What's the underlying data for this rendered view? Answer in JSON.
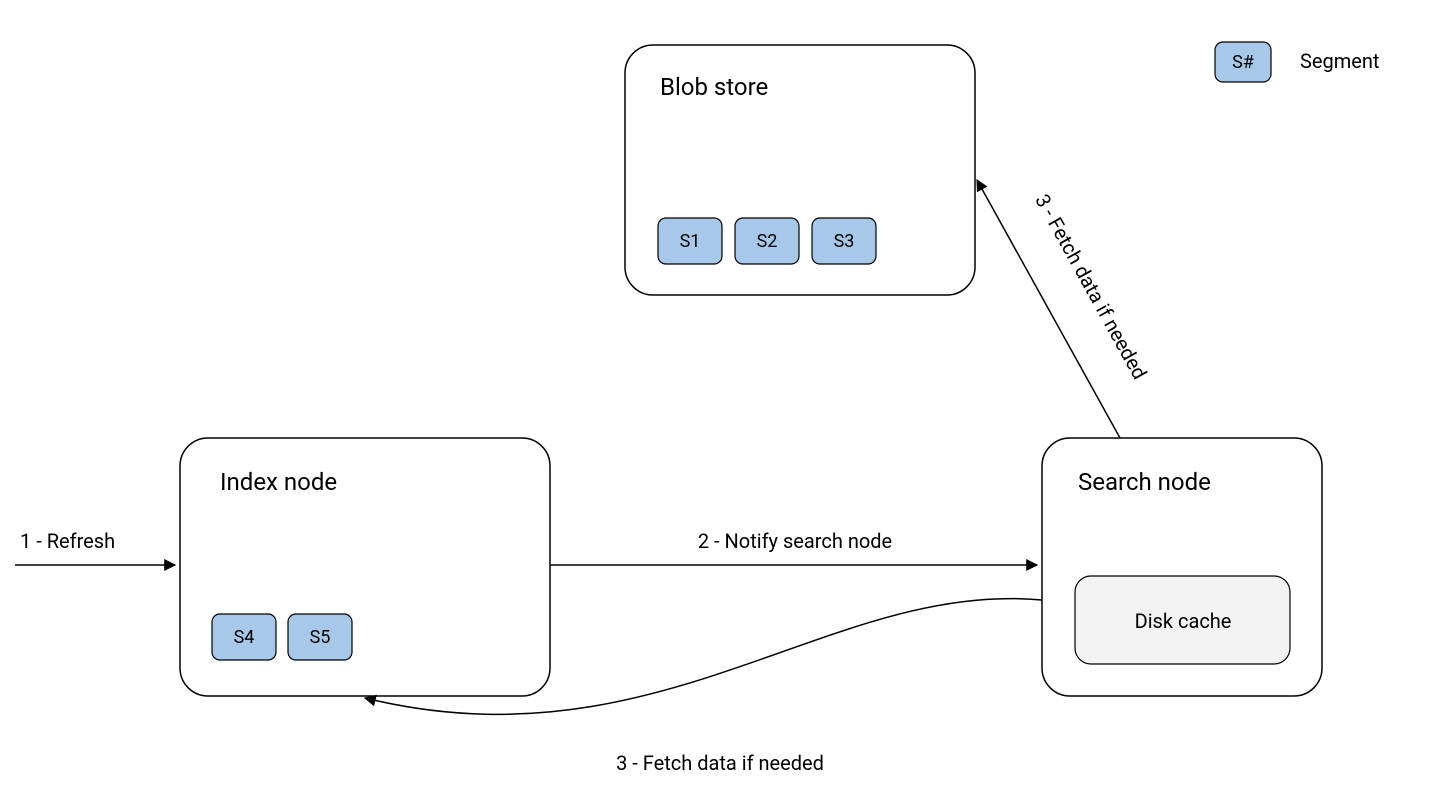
{
  "legend": {
    "swatch_label": "S#",
    "description": "Segment"
  },
  "nodes": {
    "blob_store": {
      "title": "Blob store",
      "segments": [
        "S1",
        "S2",
        "S3"
      ]
    },
    "index_node": {
      "title": "Index node",
      "segments": [
        "S4",
        "S5"
      ]
    },
    "search_node": {
      "title": "Search node",
      "cache_label": "Disk cache"
    }
  },
  "edges": {
    "refresh": "1 - Refresh",
    "notify": "2 - Notify search node",
    "fetch_blob": "3 - Fetch data if needed",
    "fetch_index": "3 - Fetch data if needed"
  },
  "colors": {
    "segment_fill": "#a7c8e8",
    "cache_fill": "#f3f3f3",
    "stroke": "#000000"
  }
}
